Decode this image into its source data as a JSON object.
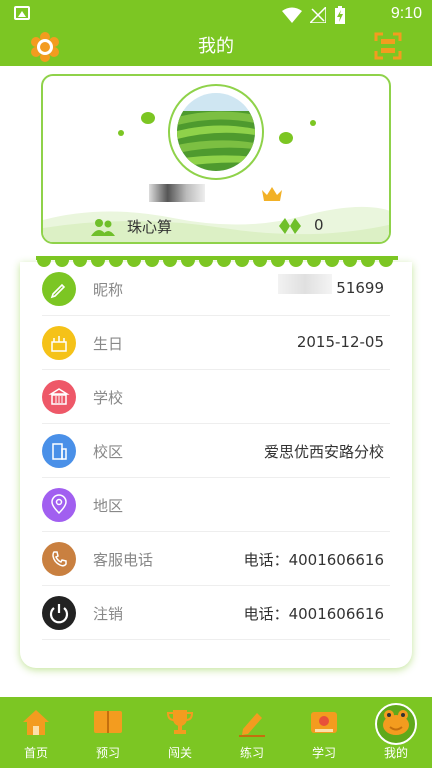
{
  "status": {
    "time": "9:10"
  },
  "header": {
    "title": "我的",
    "left_icon": "flower-settings-icon",
    "right_icon": "scan-icon"
  },
  "profile": {
    "group_name": "珠心算",
    "gem_count": "0"
  },
  "info": {
    "nickname": {
      "label": "昵称",
      "value": "51699"
    },
    "birthday": {
      "label": "生日",
      "value": "2015-12-05"
    },
    "school": {
      "label": "学校",
      "value": ""
    },
    "campus": {
      "label": "校区",
      "value": "爱思优西安路分校"
    },
    "region": {
      "label": "地区",
      "value": ""
    },
    "service": {
      "label": "客服电话",
      "value": "电话：4001606616"
    },
    "logout": {
      "label": "注销",
      "value": "电话：4001606616"
    }
  },
  "tabs": [
    {
      "label": "首页",
      "icon": "home-icon"
    },
    {
      "label": "预习",
      "icon": "book-icon"
    },
    {
      "label": "闯关",
      "icon": "trophy-icon"
    },
    {
      "label": "练习",
      "icon": "pencil-icon"
    },
    {
      "label": "学习",
      "icon": "study-icon"
    },
    {
      "label": "我的",
      "icon": "frog-icon"
    }
  ],
  "colors": {
    "brand": "#7cc623",
    "tab_active": "#5fa91a"
  }
}
